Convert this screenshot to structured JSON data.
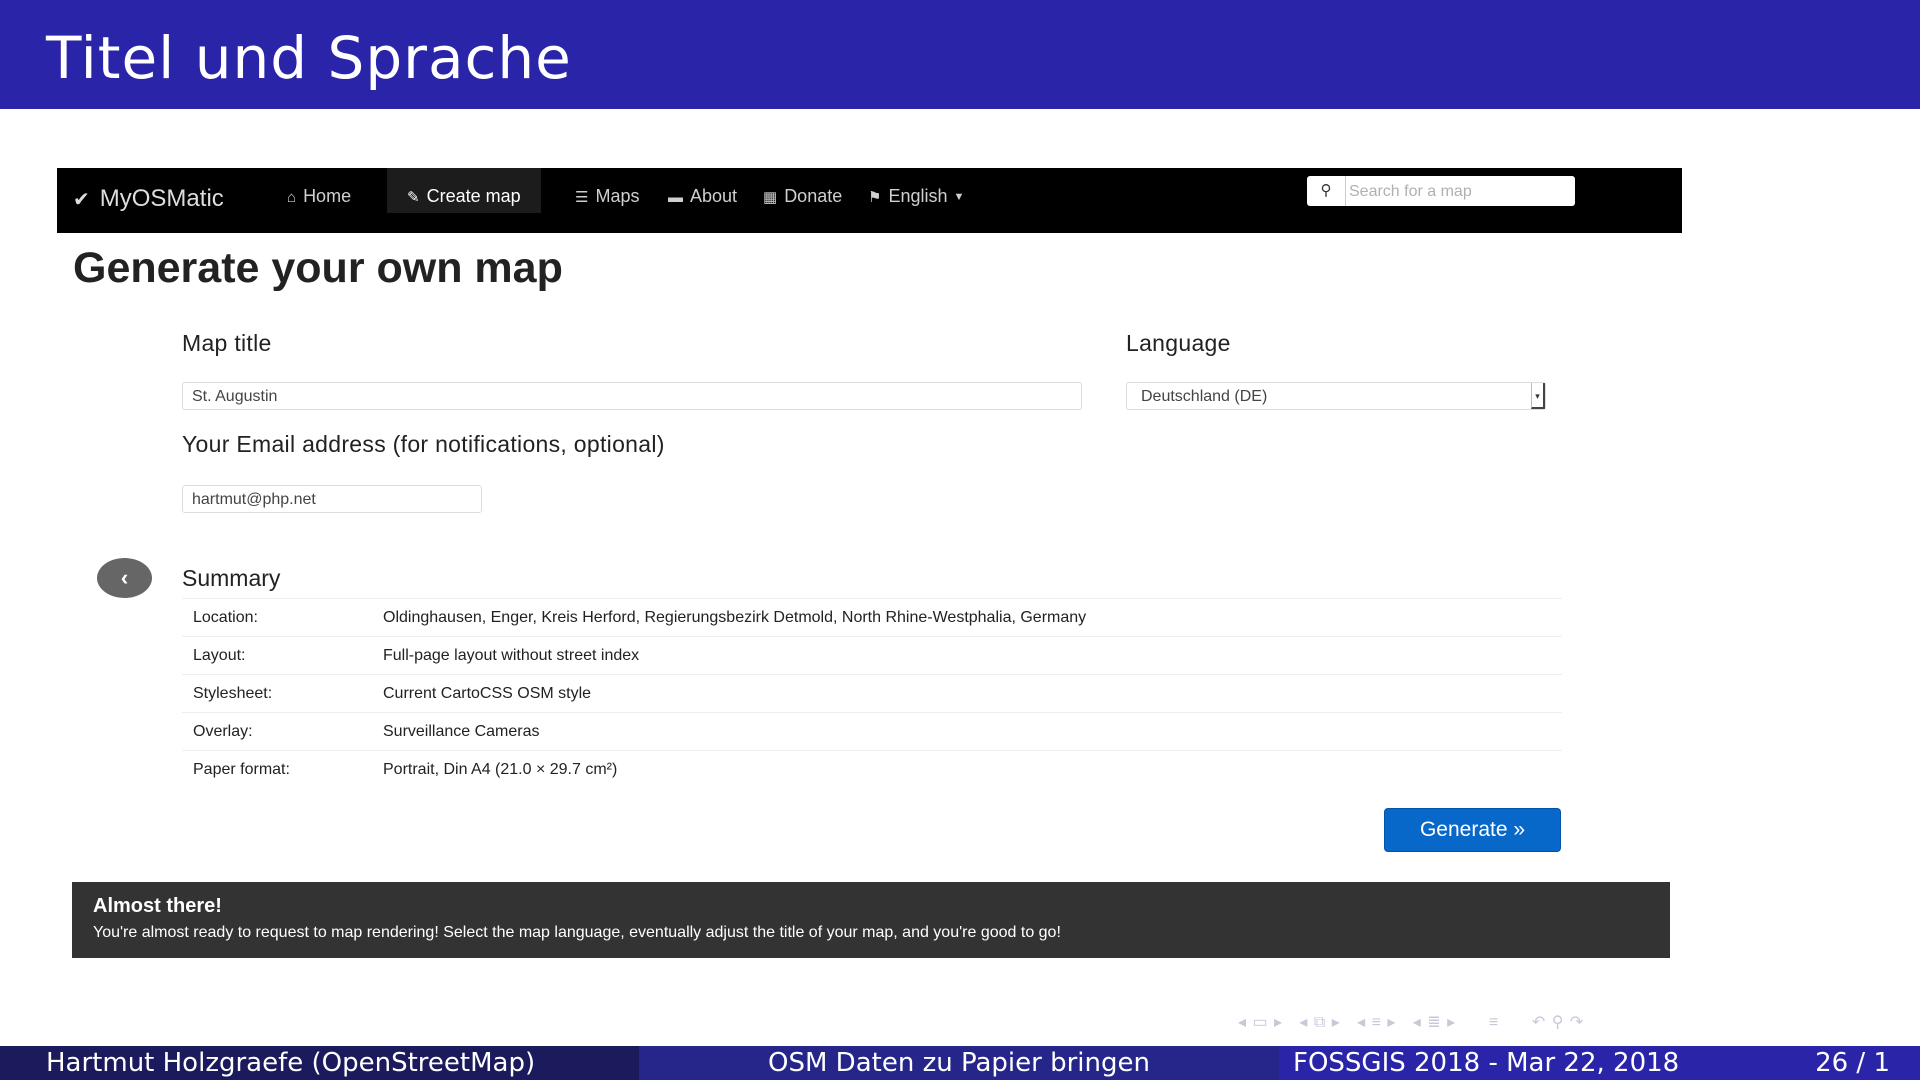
{
  "slide": {
    "title": "Titel und Sprache",
    "footer": {
      "author": "Hartmut Holzgraefe  (OpenStreetMap)",
      "talk_title": "OSM Daten zu Papier bringen",
      "event": "FOSSGIS 2018 - Mar 22, 2018",
      "page": "26 / 1"
    },
    "nav_icons": [
      "frame-nav-icon",
      "section-nav-icon",
      "subsection-nav-icon",
      "slide-nav-icon",
      "back-icon",
      "search-icon",
      "forward-icon"
    ]
  },
  "app": {
    "brand": "MyOSMatic",
    "nav": [
      {
        "label": "Home",
        "icon": "home-icon"
      },
      {
        "label": "Create map",
        "icon": "edit-icon"
      },
      {
        "label": "Maps",
        "icon": "list-icon"
      },
      {
        "label": "About",
        "icon": "comment-icon"
      },
      {
        "label": "Donate",
        "icon": "gift-icon"
      },
      {
        "label": "English",
        "icon": "flag-icon"
      }
    ],
    "search_placeholder": "Search for a map",
    "page_title": "Generate your own map",
    "form": {
      "map_title_label": "Map title",
      "map_title_value": "St. Augustin",
      "language_label": "Language",
      "language_value": "Deutschland (DE)",
      "email_label": "Your Email address (for notifications, optional)",
      "email_value": "hartmut@php.net"
    },
    "summary": {
      "title": "Summary",
      "rows": [
        {
          "key": "Location:",
          "value": "Oldinghausen, Enger, Kreis Herford, Regierungsbezirk Detmold, North Rhine-Westphalia, Germany"
        },
        {
          "key": "Layout:",
          "value": "Full-page layout without street index"
        },
        {
          "key": "Stylesheet:",
          "value": "Current CartoCSS OSM style"
        },
        {
          "key": "Overlay:",
          "value": "Surveillance Cameras"
        },
        {
          "key": "Paper format:",
          "value": "Portrait, Din A4 (21.0 × 29.7 cm²)"
        }
      ]
    },
    "generate_label": "Generate »",
    "alert": {
      "title": "Almost there!",
      "text": "You're almost ready to request to map rendering! Select the map language, eventually adjust the title of your map, and you're good to go!"
    }
  },
  "colors": {
    "header_bg": "#2a24a8",
    "navbar_bg": "#000000",
    "button_bg": "#0868c9",
    "alert_bg": "#333333"
  }
}
